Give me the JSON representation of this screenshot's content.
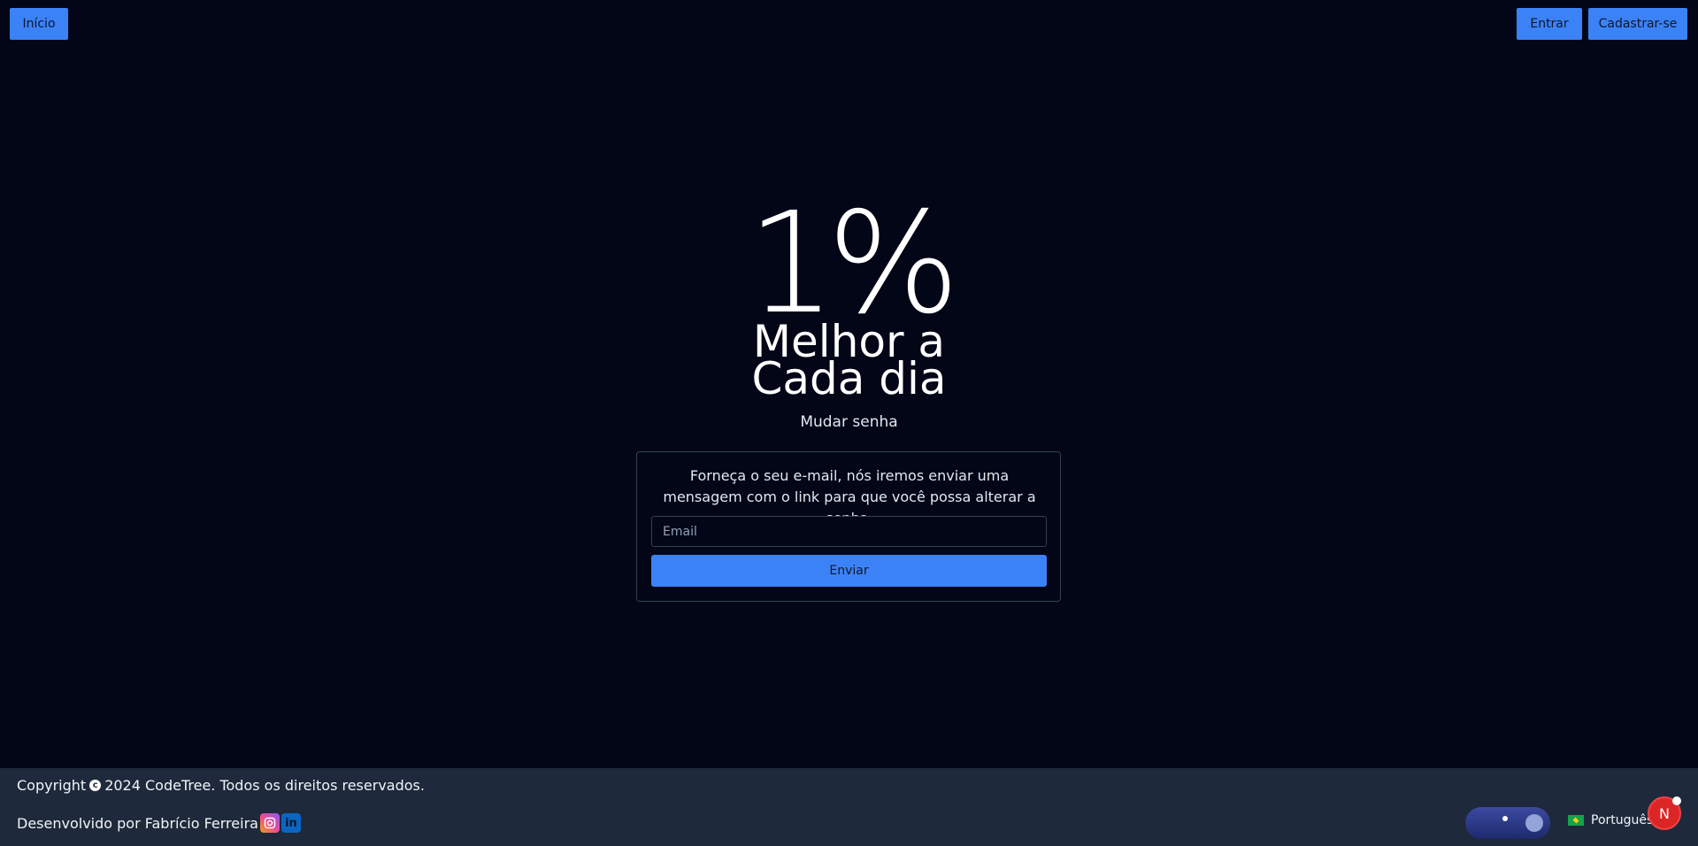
{
  "header": {
    "home_label": "Início",
    "login_label": "Entrar",
    "signup_label": "Cadastrar-se"
  },
  "brand": {
    "big": "1%",
    "line1": "Melhor a",
    "line2": "Cada dia"
  },
  "page": {
    "subtitle": "Mudar senha"
  },
  "form": {
    "description": "Forneça o seu e-mail, nós iremos enviar uma mensagem com o link para que você possa alterar a senha.",
    "email_placeholder": "Email",
    "email_value": "",
    "submit_label": "Enviar"
  },
  "footer": {
    "copyright_prefix": "Copyright",
    "copyright_text": "2024 CodeTree. Todos os direitos reservados.",
    "developer_text": "Desenvolvido por Fabrício Ferreira",
    "language": "Português",
    "avatar_letter": "N"
  },
  "colors": {
    "background": "#020617",
    "accent": "#3b82f6",
    "footer": "#1e293b"
  },
  "icons": [
    "copyright-icon",
    "instagram-icon",
    "linkedin-icon",
    "theme-toggle-moon",
    "brazil-flag-icon",
    "avatar-badge"
  ]
}
